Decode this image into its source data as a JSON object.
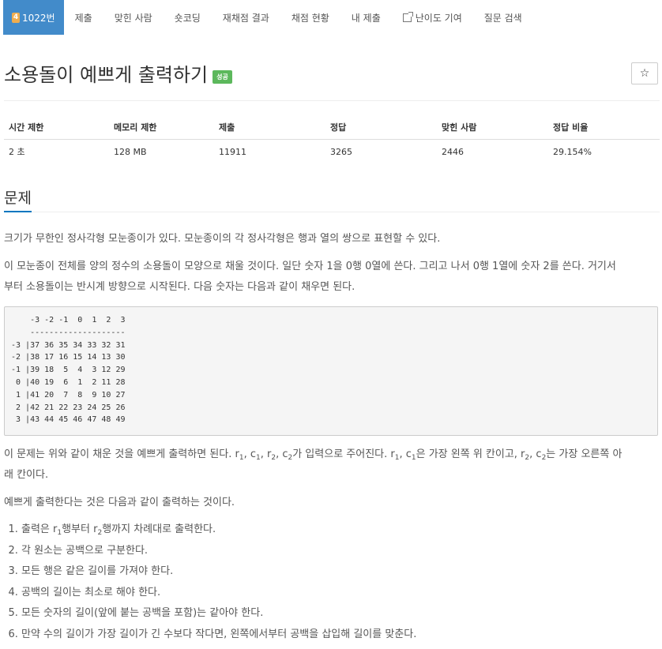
{
  "nav": {
    "problem_number": "1022번",
    "medal_level": "4",
    "items": [
      "제출",
      "맞힌 사람",
      "숏코딩",
      "재채점 결과",
      "채점 현황",
      "내 제출",
      "난이도 기여",
      "질문 검색"
    ]
  },
  "problem": {
    "title": "소용돌이 예쁘게 출력하기",
    "badge": "성공",
    "star": "☆"
  },
  "info_table": {
    "headers": [
      "시간 제한",
      "메모리 제한",
      "제출",
      "정답",
      "맞힌 사람",
      "정답 비율"
    ],
    "values": [
      "2 초",
      "128 MB",
      "11911",
      "3265",
      "2446",
      "29.154%"
    ]
  },
  "section": {
    "title": "문제"
  },
  "body": {
    "p1": "크기가 무한인 정사각형 모눈종이가 있다. 모눈종이의 각 정사각형은 행과 열의 쌍으로 표현할 수 있다.",
    "p2_line1": "이 모눈종이 전체를 양의 정수의 소용돌이 모양으로 채울 것이다. 일단 숫자 1을 0행 0열에 쓴다. 그리고 나서 0행 1열에 숫자 2를 쓴다. 거기서",
    "p2_line2": "부터 소용돌이는 반시계 방향으로 시작된다. 다음 숫자는 다음과 같이 채우면 된다.",
    "grid": "    -3 -2 -1  0  1  2  3\n    --------------------\n-3 |37 36 35 34 33 32 31\n-2 |38 17 16 15 14 13 30\n-1 |39 18  5  4  3 12 29\n 0 |40 19  6  1  2 11 28\n 1 |41 20  7  8  9 10 27\n 2 |42 21 22 23 24 25 26\n 3 |43 44 45 46 47 48 49",
    "p3_a": "이 문제는 위와 같이 채운 것을 예쁘게 출력하면 된다. r",
    "p3_b": ", c",
    "p3_c": ", r",
    "p3_d": ", c",
    "p3_e": "가 입력으로 주어진다. r",
    "p3_f": ", c",
    "p3_g": "은 가장 왼쪽 위 칸이고, r",
    "p3_h": ", c",
    "p3_i": "는 가장 오른쪽 아",
    "p3_line2": "래 칸이다.",
    "sub1": "1",
    "sub2": "2",
    "p4": "예쁘게 출력한다는 것은 다음과 같이 출력하는 것이다.",
    "li1_a": "출력은 r",
    "li1_b": "행부터 r",
    "li1_c": "행까지 차례대로 출력한다.",
    "li2": "각 원소는 공백으로 구분한다.",
    "li3": "모든 행은 같은 길이를 가져야 한다.",
    "li4": "공백의 길이는 최소로 해야 한다.",
    "li5": "모든 숫자의 길이(앞에 붙는 공백을 포함)는 같아야 한다.",
    "li6": "만약 수의 길이가 가장 길이가 긴 수보다 작다면, 왼쪽에서부터 공백을 삽입해 길이를 맞춘다."
  }
}
